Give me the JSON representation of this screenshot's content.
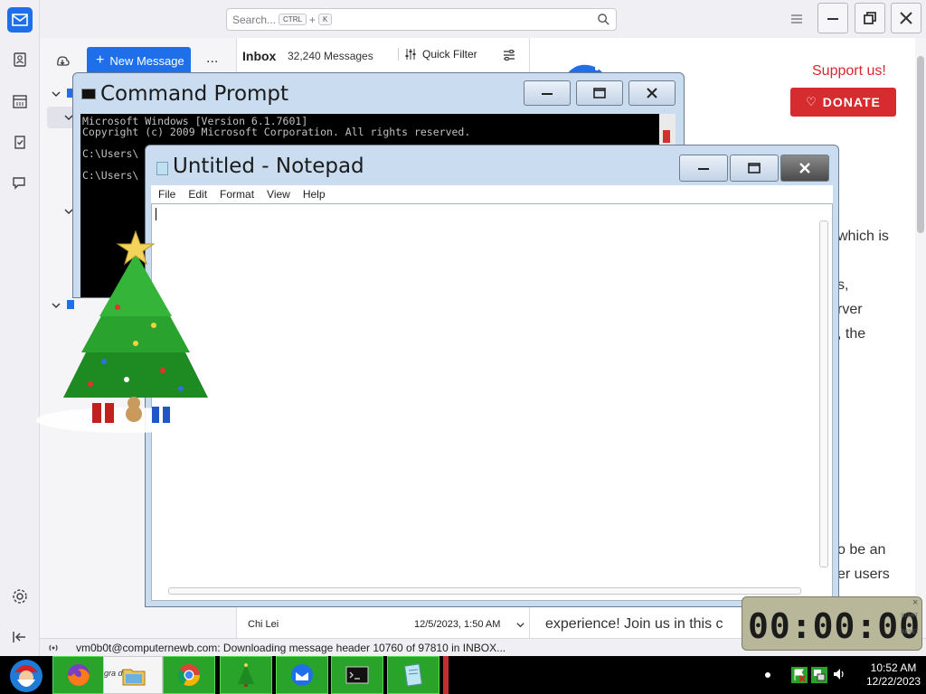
{
  "thunderbird": {
    "search_placeholder": "Search...",
    "search_kbd_1": "CTRL",
    "search_kbd_plus": "+",
    "search_kbd_2": "K",
    "new_message_label": "New Message",
    "folder_more_label": "...",
    "inbox_label": "Inbox",
    "inbox_count": "32,240 Messages",
    "quick_filter_label": "Quick Filter",
    "row_sender": "Chi Lei",
    "row_date": "12/5/2023, 1:50 AM",
    "status_text": "vm0b0t@computernewb.com: Downloading message header 10760 of 97810 in INBOX...",
    "support_us": "Support us!",
    "donate_label": "DONATE",
    "web_fragments": [
      "which is",
      "s,",
      "rver",
      ", the",
      "o be an",
      "er users",
      "experience! Join us in this c"
    ],
    "accent_color": "#1f6feb",
    "donate_color": "#d62c2f"
  },
  "cmd": {
    "title": "Command Prompt",
    "lines": [
      "Microsoft Windows [Version 6.1.7601]",
      "Copyright (c) 2009 Microsoft Corporation.  All rights reserved.",
      "",
      "C:\\Users\\",
      "",
      "C:\\Users\\"
    ]
  },
  "notepad": {
    "title": "Untitled - Notepad",
    "menu": [
      "File",
      "Edit",
      "Format",
      "View",
      "Help"
    ]
  },
  "timer": {
    "display": "00:00:00",
    "close": "×",
    "start": "START",
    "reset": "RESET"
  },
  "taskbar": {
    "folder_label": "gra    d f",
    "clock_time": "10:52 AM",
    "clock_date": "12/22/2023"
  }
}
